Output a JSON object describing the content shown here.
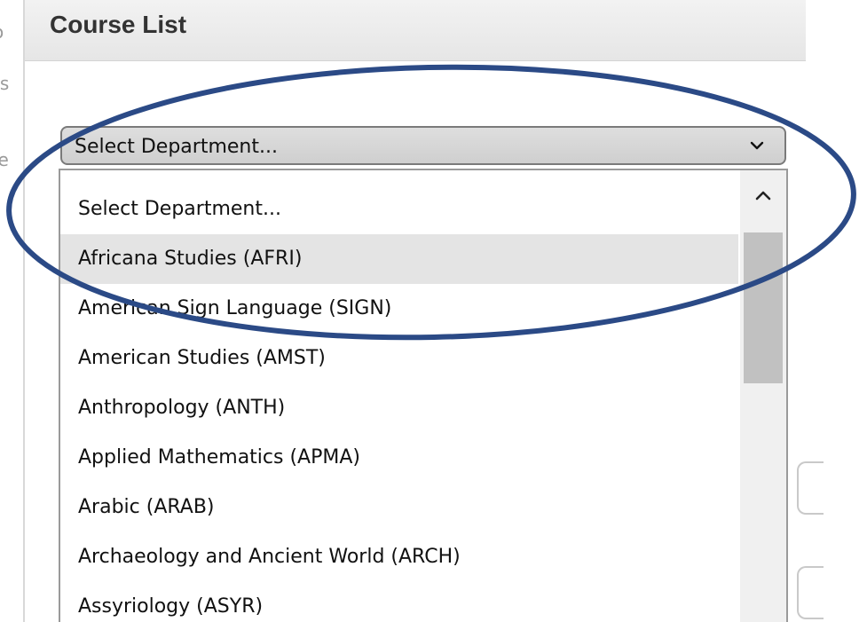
{
  "header": {
    "title": "Course List"
  },
  "left_fragments": [
    "o",
    "ts",
    "le"
  ],
  "department_select": {
    "selected_value": "Select Department..."
  },
  "dropdown": {
    "options": [
      "Select Department...",
      "Africana Studies (AFRI)",
      "American Sign Language (SIGN)",
      "American Studies (AMST)",
      "Anthropology (ANTH)",
      "Applied Mathematics (APMA)",
      "Arabic (ARAB)",
      "Archaeology and Ancient World (ARCH)",
      "Assyriology (ASYR)"
    ],
    "highlighted_index": 1
  },
  "colors": {
    "annotation": "#2b4a86",
    "highlight": "#e4e4e4",
    "scroll_thumb": "#c1c1c1"
  },
  "icons": {
    "select_arrow": "chevron-down-icon",
    "scroll_up": "chevron-up-icon"
  }
}
